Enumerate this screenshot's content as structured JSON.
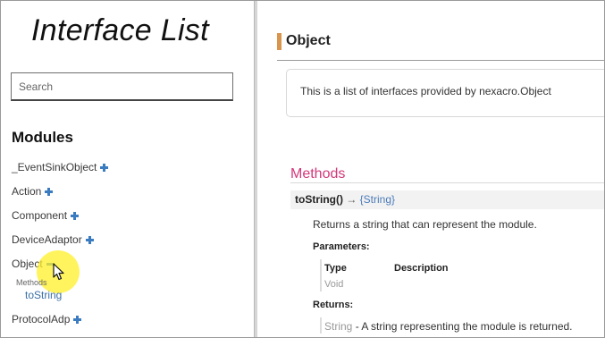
{
  "sidebar": {
    "title": "Interface List",
    "search_placeholder": "Search",
    "modules_heading": "Modules",
    "modules": [
      {
        "label": "_EventSinkObject",
        "state": "collapsed"
      },
      {
        "label": "Action",
        "state": "collapsed"
      },
      {
        "label": "Component",
        "state": "collapsed"
      },
      {
        "label": "DeviceAdaptor",
        "state": "collapsed"
      },
      {
        "label": "Object",
        "state": "expanded"
      },
      {
        "label": "ProtocolAdp",
        "state": "collapsed"
      }
    ],
    "expanded": {
      "section_label": "Methods",
      "items": [
        "toString"
      ]
    }
  },
  "main": {
    "title": "Object",
    "description": "This is a list of interfaces provided by nexacro.Object",
    "methods_heading": "Methods",
    "method": {
      "name": "toString()",
      "arrow": "→",
      "return_type": "{String}",
      "description": "Returns a string that can represent the module.",
      "parameters_label": "Parameters:",
      "param_headers": {
        "type": "Type",
        "description": "Description"
      },
      "param_rows": [
        {
          "type": "Void",
          "description": ""
        }
      ],
      "returns_label": "Returns:",
      "returns": {
        "type": "String",
        "text": " - A string representing the module is returned."
      }
    }
  },
  "colors": {
    "accent_bar": "#d9954d",
    "methods_heading": "#d4377a",
    "icon_blue": "#3b7bbf",
    "link_blue": "#4b7cb8",
    "cursor_highlight": "#fff028"
  },
  "icons": [
    "plus-icon",
    "minus-icon",
    "mouse-cursor-icon"
  ]
}
